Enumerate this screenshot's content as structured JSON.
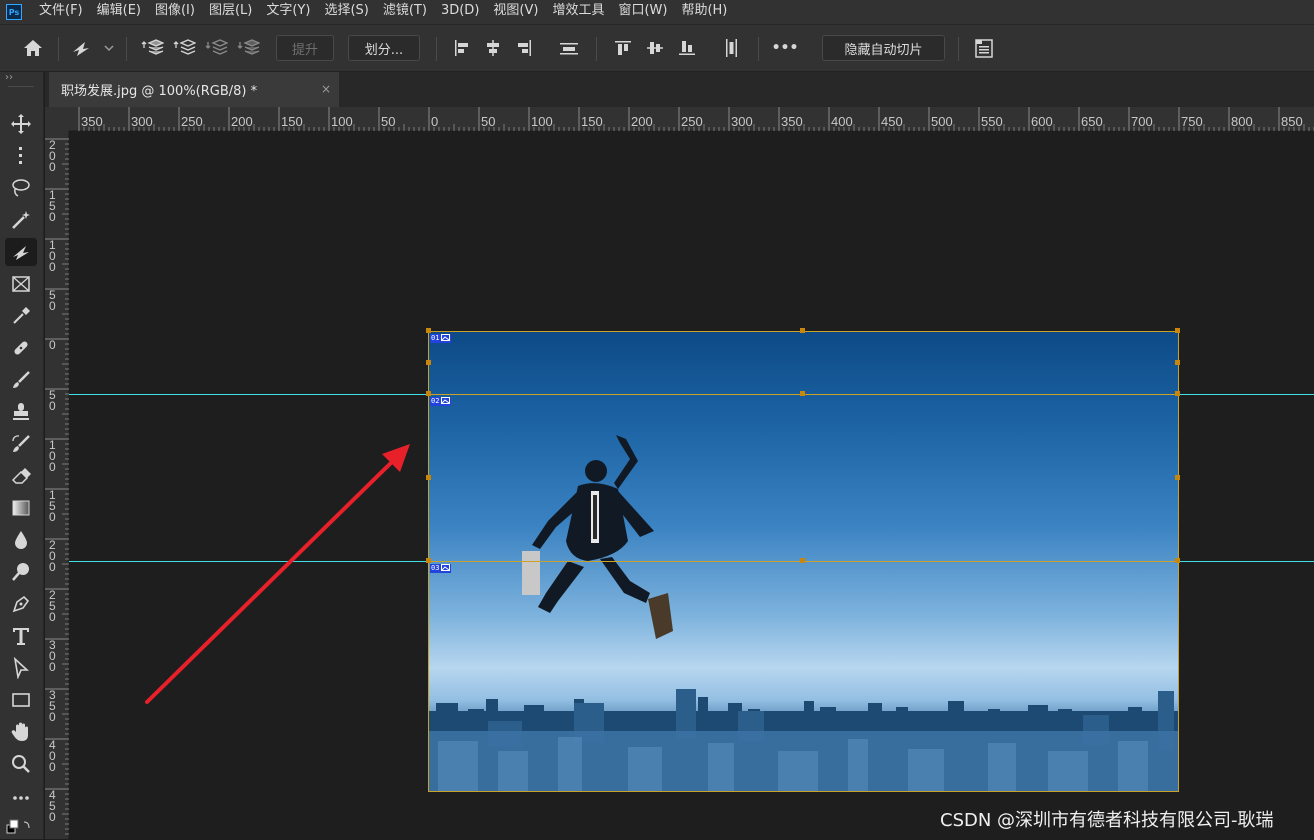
{
  "app": {
    "logo_text": "Ps"
  },
  "menu": [
    "文件(F)",
    "编辑(E)",
    "图像(I)",
    "图层(L)",
    "文字(Y)",
    "选择(S)",
    "滤镜(T)",
    "3D(D)",
    "视图(V)",
    "增效工具",
    "窗口(W)",
    "帮助(H)"
  ],
  "options": {
    "promote_label": "提升",
    "divide_label": "划分...",
    "hide_auto_slices_label": "隐藏自动切片",
    "more_label": "•••"
  },
  "document": {
    "tab_title": "职场发展.jpg @ 100%(RGB/8) *",
    "close_glyph": "×"
  },
  "rulers": {
    "horizontal_labels": [
      "350",
      "300",
      "250",
      "200",
      "150",
      "100",
      "50",
      "0",
      "50",
      "100",
      "150",
      "200",
      "250",
      "300",
      "350",
      "400",
      "450",
      "500",
      "550",
      "600",
      "650",
      "700",
      "750",
      "800",
      "850"
    ],
    "vertical_labels": [
      "200",
      "150",
      "100",
      "50",
      "0",
      "50",
      "100",
      "150",
      "200",
      "250",
      "300",
      "350",
      "400",
      "450"
    ]
  },
  "slices": [
    {
      "number": "01"
    },
    {
      "number": "02"
    },
    {
      "number": "03"
    }
  ],
  "colors": {
    "guide": "#3fe0e6",
    "slice_border": "#c9a227",
    "slice_badge": "#2244dd",
    "arrow": "#e8202a"
  },
  "watermark": "CSDN @深圳市有德者科技有限公司-耿瑞"
}
